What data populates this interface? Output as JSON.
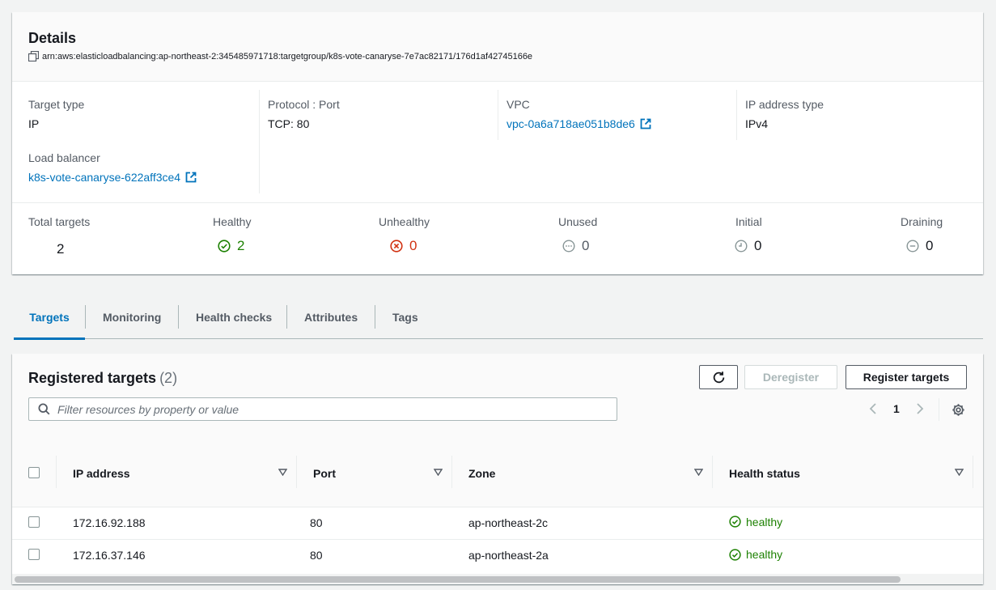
{
  "details": {
    "title": "Details",
    "arn": "arn:aws:elasticloadbalancing:ap-northeast-2:345485971718:targetgroup/k8s-vote-canaryse-7e7ac82171/176d1af42745166e",
    "target_type": {
      "label": "Target type",
      "value": "IP"
    },
    "protocol_port": {
      "label": "Protocol : Port",
      "value": "TCP: 80"
    },
    "vpc": {
      "label": "VPC",
      "value": "vpc-0a6a718ae051b8de6"
    },
    "ip_address_type": {
      "label": "IP address type",
      "value": "IPv4"
    },
    "load_balancer": {
      "label": "Load balancer",
      "value": "k8s-vote-canaryse-622aff3ce4"
    }
  },
  "counts": {
    "total": {
      "label": "Total targets",
      "value": "2"
    },
    "healthy": {
      "label": "Healthy",
      "value": "2"
    },
    "unhealthy": {
      "label": "Unhealthy",
      "value": "0"
    },
    "unused": {
      "label": "Unused",
      "value": "0"
    },
    "initial": {
      "label": "Initial",
      "value": "0"
    },
    "draining": {
      "label": "Draining",
      "value": "0"
    }
  },
  "tabs": [
    "Targets",
    "Monitoring",
    "Health checks",
    "Attributes",
    "Tags"
  ],
  "registered": {
    "title": "Registered targets",
    "count": "(2)",
    "refresh_icon": "refresh-icon",
    "deregister_label": "Deregister",
    "register_label": "Register targets",
    "filter_placeholder": "Filter resources by property or value",
    "page": "1"
  },
  "table": {
    "headers": [
      "IP address",
      "Port",
      "Zone",
      "Health status"
    ],
    "rows": [
      {
        "ip": "172.16.92.188",
        "port": "80",
        "zone": "ap-northeast-2c",
        "health": "healthy"
      },
      {
        "ip": "172.16.37.146",
        "port": "80",
        "zone": "ap-northeast-2a",
        "health": "healthy"
      }
    ]
  },
  "colors": {
    "link": "#0073bb",
    "healthy": "#1d8102",
    "unhealthy": "#d13212",
    "neutral": "#879596"
  }
}
